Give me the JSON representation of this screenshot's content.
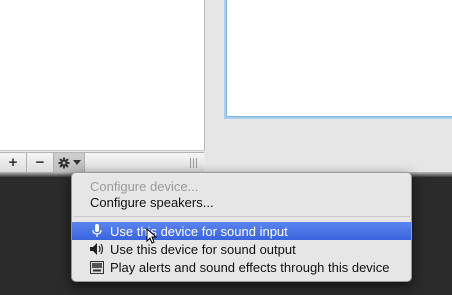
{
  "toolbar": {
    "add_label": "+",
    "remove_label": "−",
    "gear_icon": "gear-icon",
    "dropdown_icon": "chevron-down-icon"
  },
  "menu": {
    "items": [
      {
        "label": "Configure device...",
        "enabled": false
      },
      {
        "label": "Configure speakers...",
        "enabled": true
      },
      {
        "label": "Use this device for sound input",
        "enabled": true,
        "selected": true,
        "icon": "microphone-icon"
      },
      {
        "label": "Use this device for sound output",
        "enabled": true,
        "icon": "speaker-icon"
      },
      {
        "label": "Play alerts and sound effects through this device",
        "enabled": true,
        "icon": "alert-icon"
      }
    ]
  },
  "colors": {
    "selection": "#3a64de",
    "focus_ring": "#a9cdee"
  }
}
